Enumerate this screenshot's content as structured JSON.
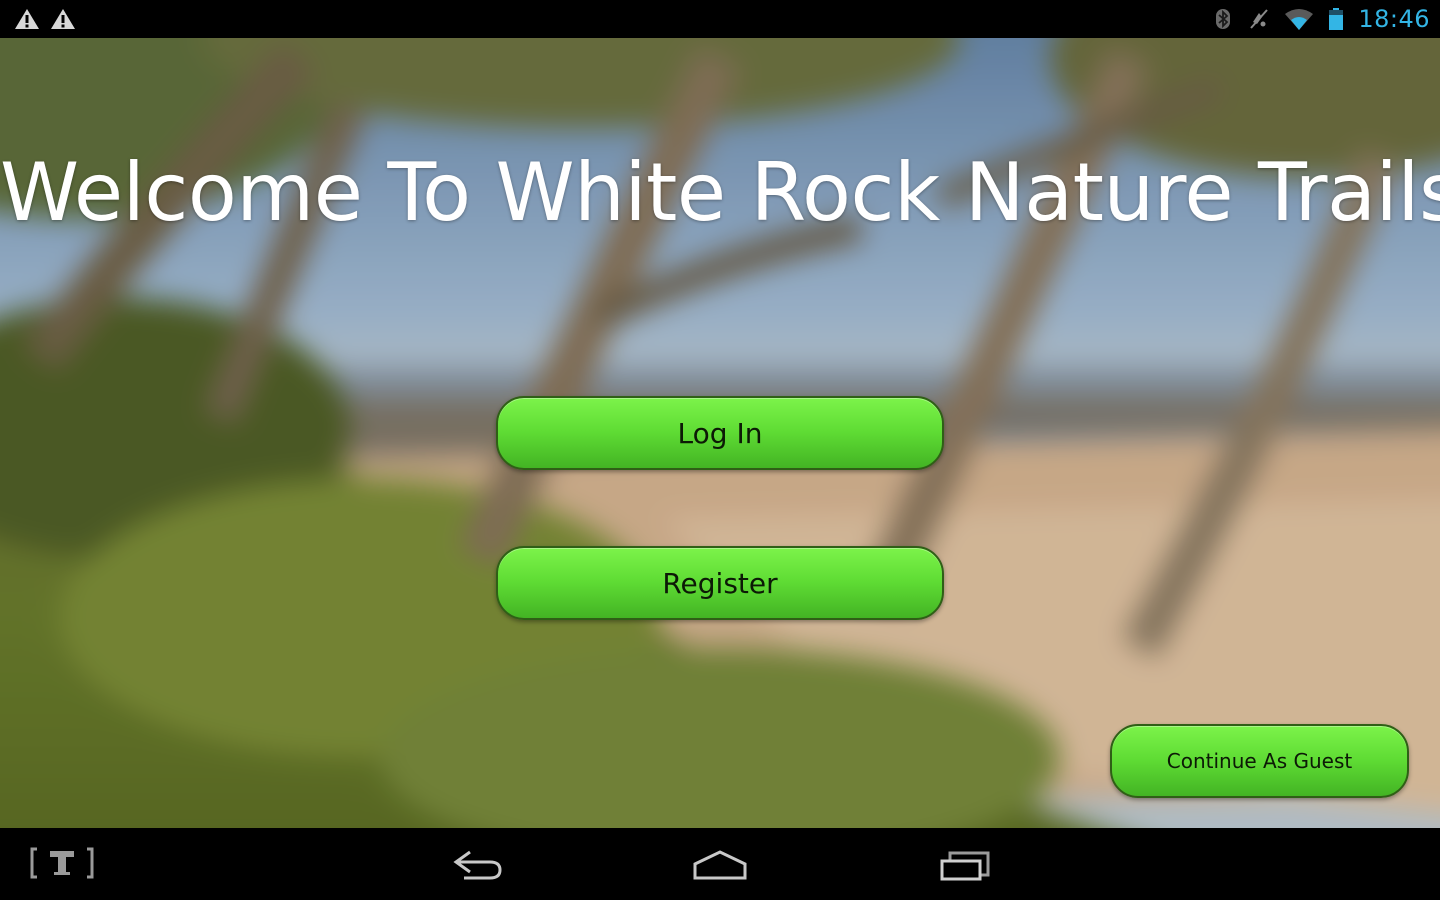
{
  "status_bar": {
    "left_icons": [
      "warning-icon",
      "warning-icon"
    ],
    "right_icons": [
      "bluetooth-icon",
      "muted-icon",
      "wifi-icon",
      "battery-icon"
    ],
    "time": "18:46",
    "time_color": "#33b5e5"
  },
  "app": {
    "title": "Welcome To White Rock Nature Trails",
    "buttons": {
      "login": "Log In",
      "register": "Register",
      "guest": "Continue As Guest"
    },
    "button_color": "#5fdc34"
  },
  "nav_bar": {
    "icons": [
      "tt-app-icon",
      "back-icon",
      "home-icon",
      "recents-icon"
    ]
  }
}
